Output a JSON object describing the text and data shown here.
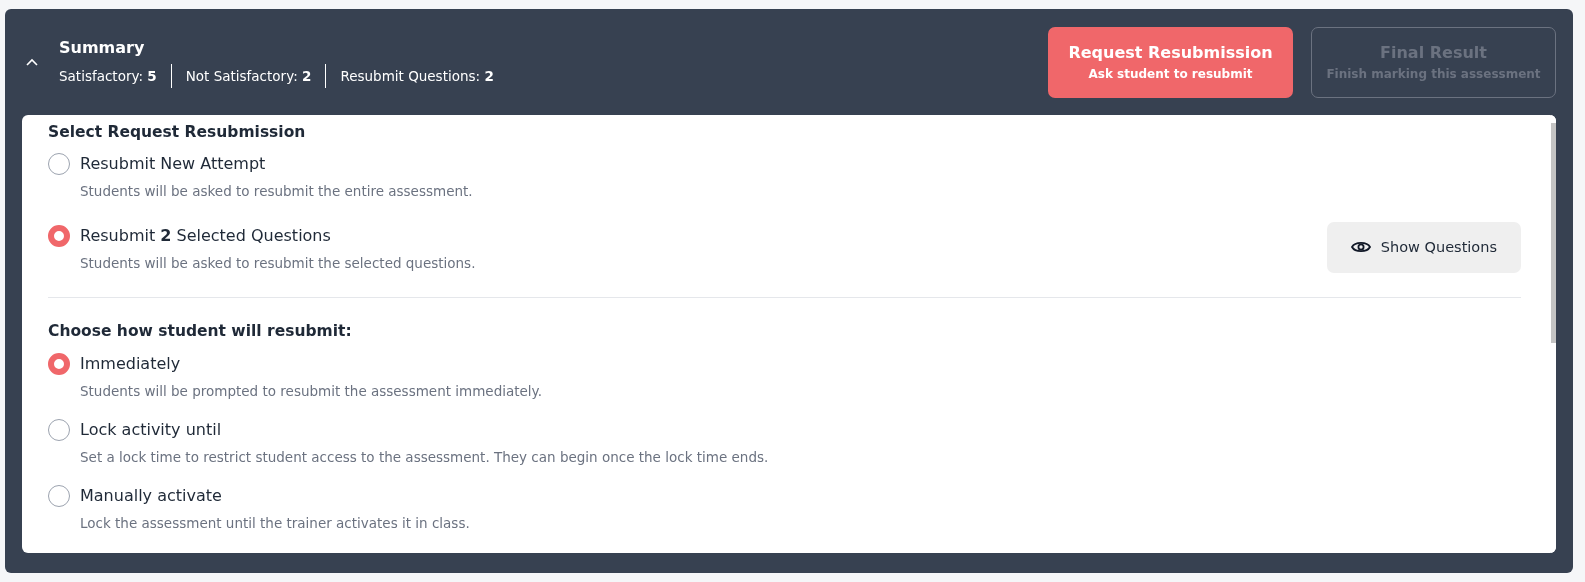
{
  "summary": {
    "title": "Summary",
    "expanded": true,
    "counts": [
      {
        "label": "Satisfactory:",
        "value": "5"
      },
      {
        "label": "Not Satisfactory:",
        "value": "2"
      },
      {
        "label": "Resubmit Questions:",
        "value": "2"
      }
    ]
  },
  "actions": [
    {
      "title": "Request Resubmission",
      "subtitle": "Ask student to resubmit",
      "kind": "primary",
      "disabled": false
    },
    {
      "title": "Final Result",
      "subtitle": "Finish marking this assessment",
      "kind": "outline",
      "disabled": true
    }
  ],
  "request_section": {
    "heading": "Select Request Resubmission",
    "options": [
      {
        "label": "Resubmit New Attempt",
        "description": "Students will be asked to resubmit the entire assessment.",
        "selected": false
      },
      {
        "label": "Resubmit **2** Selected Questions",
        "description": "Students will be asked to resubmit the selected questions.",
        "selected": true,
        "button": "Show Questions"
      }
    ]
  },
  "resubmit_section": {
    "heading": "Choose how student will resubmit:",
    "options": [
      {
        "label": "Immediately",
        "description": "Students will be prompted to resubmit the assessment immediately.",
        "selected": true
      },
      {
        "label": "Lock activity until",
        "description": "Set a lock time to restrict student access to the assessment. They can begin once the lock time ends.",
        "selected": false
      },
      {
        "label": "Manually activate",
        "description": "Lock the assessment until the trainer activates it in class.",
        "selected": false
      }
    ]
  }
}
